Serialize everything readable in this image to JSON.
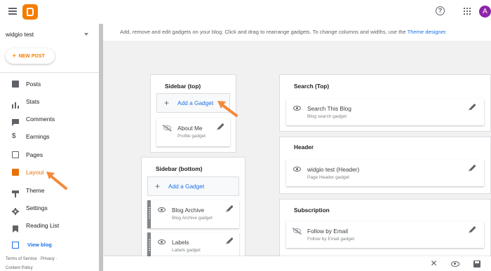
{
  "app": {
    "avatar_letter": "A",
    "brand_color": "#f57d00"
  },
  "sidebar": {
    "blog_name": "widgio test",
    "new_post_label": "NEW POST",
    "items": [
      {
        "label": "Posts",
        "icon": "posts-icon"
      },
      {
        "label": "Stats",
        "icon": "stats-icon"
      },
      {
        "label": "Comments",
        "icon": "comments-icon"
      },
      {
        "label": "Earnings",
        "icon": "dollar-icon"
      },
      {
        "label": "Pages",
        "icon": "pages-icon"
      },
      {
        "label": "Layout",
        "icon": "layout-icon",
        "active": true
      },
      {
        "label": "Theme",
        "icon": "theme-icon"
      },
      {
        "label": "Settings",
        "icon": "gear-icon"
      },
      {
        "label": "Reading List",
        "icon": "bookmark-icon"
      }
    ],
    "view_blog": "View blog",
    "footer": {
      "terms": "Terms of Service",
      "privacy": "Privacy",
      "content_policy": "Content Policy"
    }
  },
  "main": {
    "info_text": "Add, remove and edit gadgets on your blog. Click and drag to rearrange gadgets. To change columns and widths, use the ",
    "info_link": "Theme designer",
    "info_end": ".",
    "sections": {
      "sidebar_top": {
        "title": "Sidebar (top)",
        "add_label": "Add a Gadget",
        "gadgets": [
          {
            "title": "About Me",
            "subtitle": "Profile gadget",
            "visible": false
          }
        ]
      },
      "sidebar_bottom": {
        "title": "Sidebar (bottom)",
        "add_label": "Add a Gadget",
        "gadgets": [
          {
            "title": "Blog Archive",
            "subtitle": "Blog Archive gadget",
            "visible": true
          },
          {
            "title": "Labels",
            "subtitle": "Labels gadget",
            "visible": true
          }
        ]
      },
      "search_top": {
        "title": "Search (Top)",
        "gadgets": [
          {
            "title": "Search This Blog",
            "subtitle": "Blog search gadget",
            "visible": true
          }
        ]
      },
      "header": {
        "title": "Header",
        "gadgets": [
          {
            "title": "widgio test (Header)",
            "subtitle": "Page Header gadget",
            "visible": true
          }
        ]
      },
      "subscription": {
        "title": "Subscription",
        "gadgets": [
          {
            "title": "Follow by Email",
            "subtitle": "Follow by Email gadget",
            "visible": false
          }
        ]
      }
    }
  },
  "bottom_bar": {
    "icons": [
      "close-icon",
      "preview-icon",
      "save-icon"
    ]
  },
  "annotation_color": "#f4893b"
}
